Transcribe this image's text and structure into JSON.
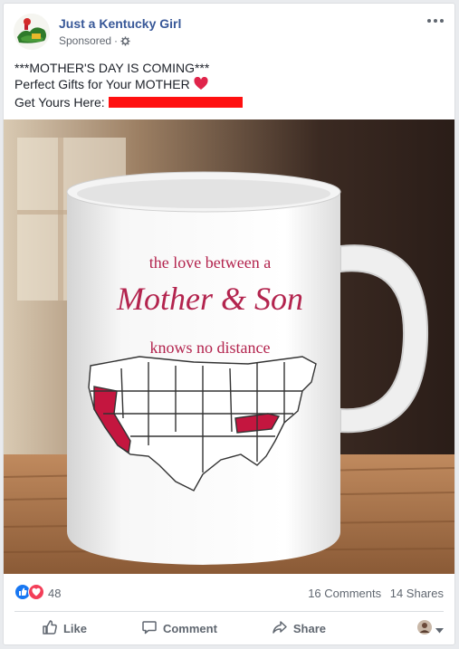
{
  "post": {
    "page_name": "Just a Kentucky Girl",
    "sponsored_label": "Sponsored",
    "sponsored_separator": "·",
    "text_line1": "***MOTHER'S DAY IS COMING***",
    "text_line2": "Perfect Gifts for Your MOTHER",
    "text_line3": "Get Yours Here:"
  },
  "mug": {
    "line1": "the love between a",
    "line2": "Mother & Son",
    "line3": "knows no distance"
  },
  "engagement": {
    "reaction_count": "48",
    "comments": "16 Comments",
    "shares": "14 Shares"
  },
  "actions": {
    "like": "Like",
    "comment": "Comment",
    "share": "Share"
  },
  "colors": {
    "brand_blue": "#385898",
    "mug_text": "#b3244e",
    "redaction": "#ff1010",
    "like_blue": "#1877f2",
    "love_red": "#f33e58"
  },
  "icons": [
    "gear-icon",
    "more-options-icon",
    "heart-emoji-icon",
    "like-reaction-icon",
    "love-reaction-icon",
    "like-icon",
    "comment-icon",
    "share-icon",
    "chevron-down-icon"
  ]
}
